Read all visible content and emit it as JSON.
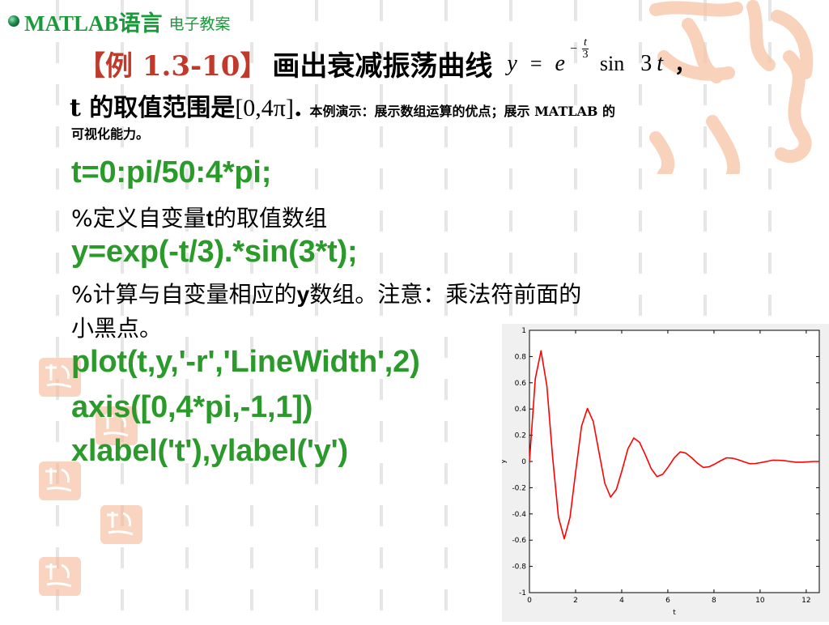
{
  "header": {
    "brand": "MATLAB语言",
    "subtitle": "电子教案"
  },
  "title": {
    "example_label": "【例 1.3-10】",
    "text": "画出衰减振荡曲线",
    "formula": {
      "lhs": "y",
      "eq": "=",
      "base": "e",
      "exp_sign": "−",
      "exp_num": "t",
      "exp_den": "3",
      "func": "sin",
      "arg_coef": "3",
      "arg_var": "t",
      "trailing": "，"
    }
  },
  "range_line": {
    "var": "t",
    "text": " 的取值范围是",
    "interval": "[0,4π]",
    "period": ".",
    "note": "本例演示：展示数组运算的优点；展示 MATLAB 的"
  },
  "desc_line2": "可视化能力。",
  "code": {
    "line1": "t=0:pi/50:4*pi;",
    "comment1_pre": "%定义自变量",
    "comment1_var": "t",
    "comment1_post": "的取值数组",
    "line2": "y=exp(-t/3).*sin(3*t);",
    "comment2_pre": "%计算与自变量相应的",
    "comment2_var": "y",
    "comment2_post": "数组。注意：乘法符前面的",
    "comment2_cont": "小黑点。",
    "line3": "plot(t,y,'-r','LineWidth',2)",
    "line4": "axis([0,4*pi,-1,1])",
    "line5": "xlabel('t'),ylabel('y')"
  },
  "chart_data": {
    "type": "line",
    "title": "",
    "xlabel": "t",
    "ylabel": "y",
    "xlim": [
      0,
      12.566
    ],
    "ylim": [
      -1,
      1
    ],
    "x_ticks": [
      0,
      2,
      4,
      6,
      8,
      10,
      12
    ],
    "y_ticks": [
      -1,
      -0.8,
      -0.6,
      -0.4,
      -0.2,
      0,
      0.2,
      0.4,
      0.6,
      0.8,
      1
    ],
    "y_tick_labels": [
      "-1",
      "-0.8",
      "-0.6",
      "-0.4",
      "-0.2",
      "0",
      "0.2",
      "0.4",
      "0.6",
      "0.8",
      "1"
    ],
    "grid": false,
    "series": [
      {
        "color": "#ff0000",
        "x": [
          0,
          0.2513,
          0.5027,
          0.754,
          1.0053,
          1.2566,
          1.508,
          1.7593,
          2.0106,
          2.2619,
          2.5133,
          2.7646,
          3.0159,
          3.2673,
          3.5186,
          3.7699,
          4.0212,
          4.2726,
          4.5239,
          4.7752,
          5.0265,
          5.2779,
          5.5292,
          5.7805,
          6.0319,
          6.2832,
          6.5345,
          6.7858,
          7.0372,
          7.2885,
          7.5398,
          7.7911,
          8.0425,
          8.2938,
          8.5451,
          8.7965,
          9.0478,
          9.2991,
          9.5504,
          9.8018,
          10.0531,
          10.3044,
          10.5558,
          10.8071,
          11.0584,
          11.3097,
          11.5611,
          11.8124,
          12.0637,
          12.315,
          12.5664
        ],
        "y": [
          0,
          0.6308,
          0.8439,
          0.5763,
          0.0337,
          -0.4244,
          -0.5893,
          -0.4249,
          -0.0682,
          0.2709,
          0.4041,
          0.3048,
          0.0703,
          -0.1665,
          -0.2717,
          -0.2132,
          -0.0623,
          0.0981,
          0.1788,
          0.1455,
          0.0503,
          -0.0549,
          -0.1154,
          -0.0971,
          -0.0381,
          0.0288,
          0.0731,
          0.0633,
          0.0275,
          -0.014,
          -0.0455,
          -0.0403,
          -0.0191,
          0.0062,
          0.0278,
          0.0252,
          0.0128,
          -0.0024,
          -0.0166,
          -0.0155,
          -0.0083,
          0.0006,
          0.0098,
          0.0094,
          0.0053,
          0.0001,
          -0.0057,
          -0.0056,
          -0.0033,
          -0.0002,
          0.0
        ]
      }
    ]
  },
  "colors": {
    "code_green": "#2a9a2a",
    "brand_green": "#1a9a3a",
    "example_red": "#c0392b",
    "deco_peach": "#f6c4a4",
    "seal_peach": "#f2b08e"
  }
}
